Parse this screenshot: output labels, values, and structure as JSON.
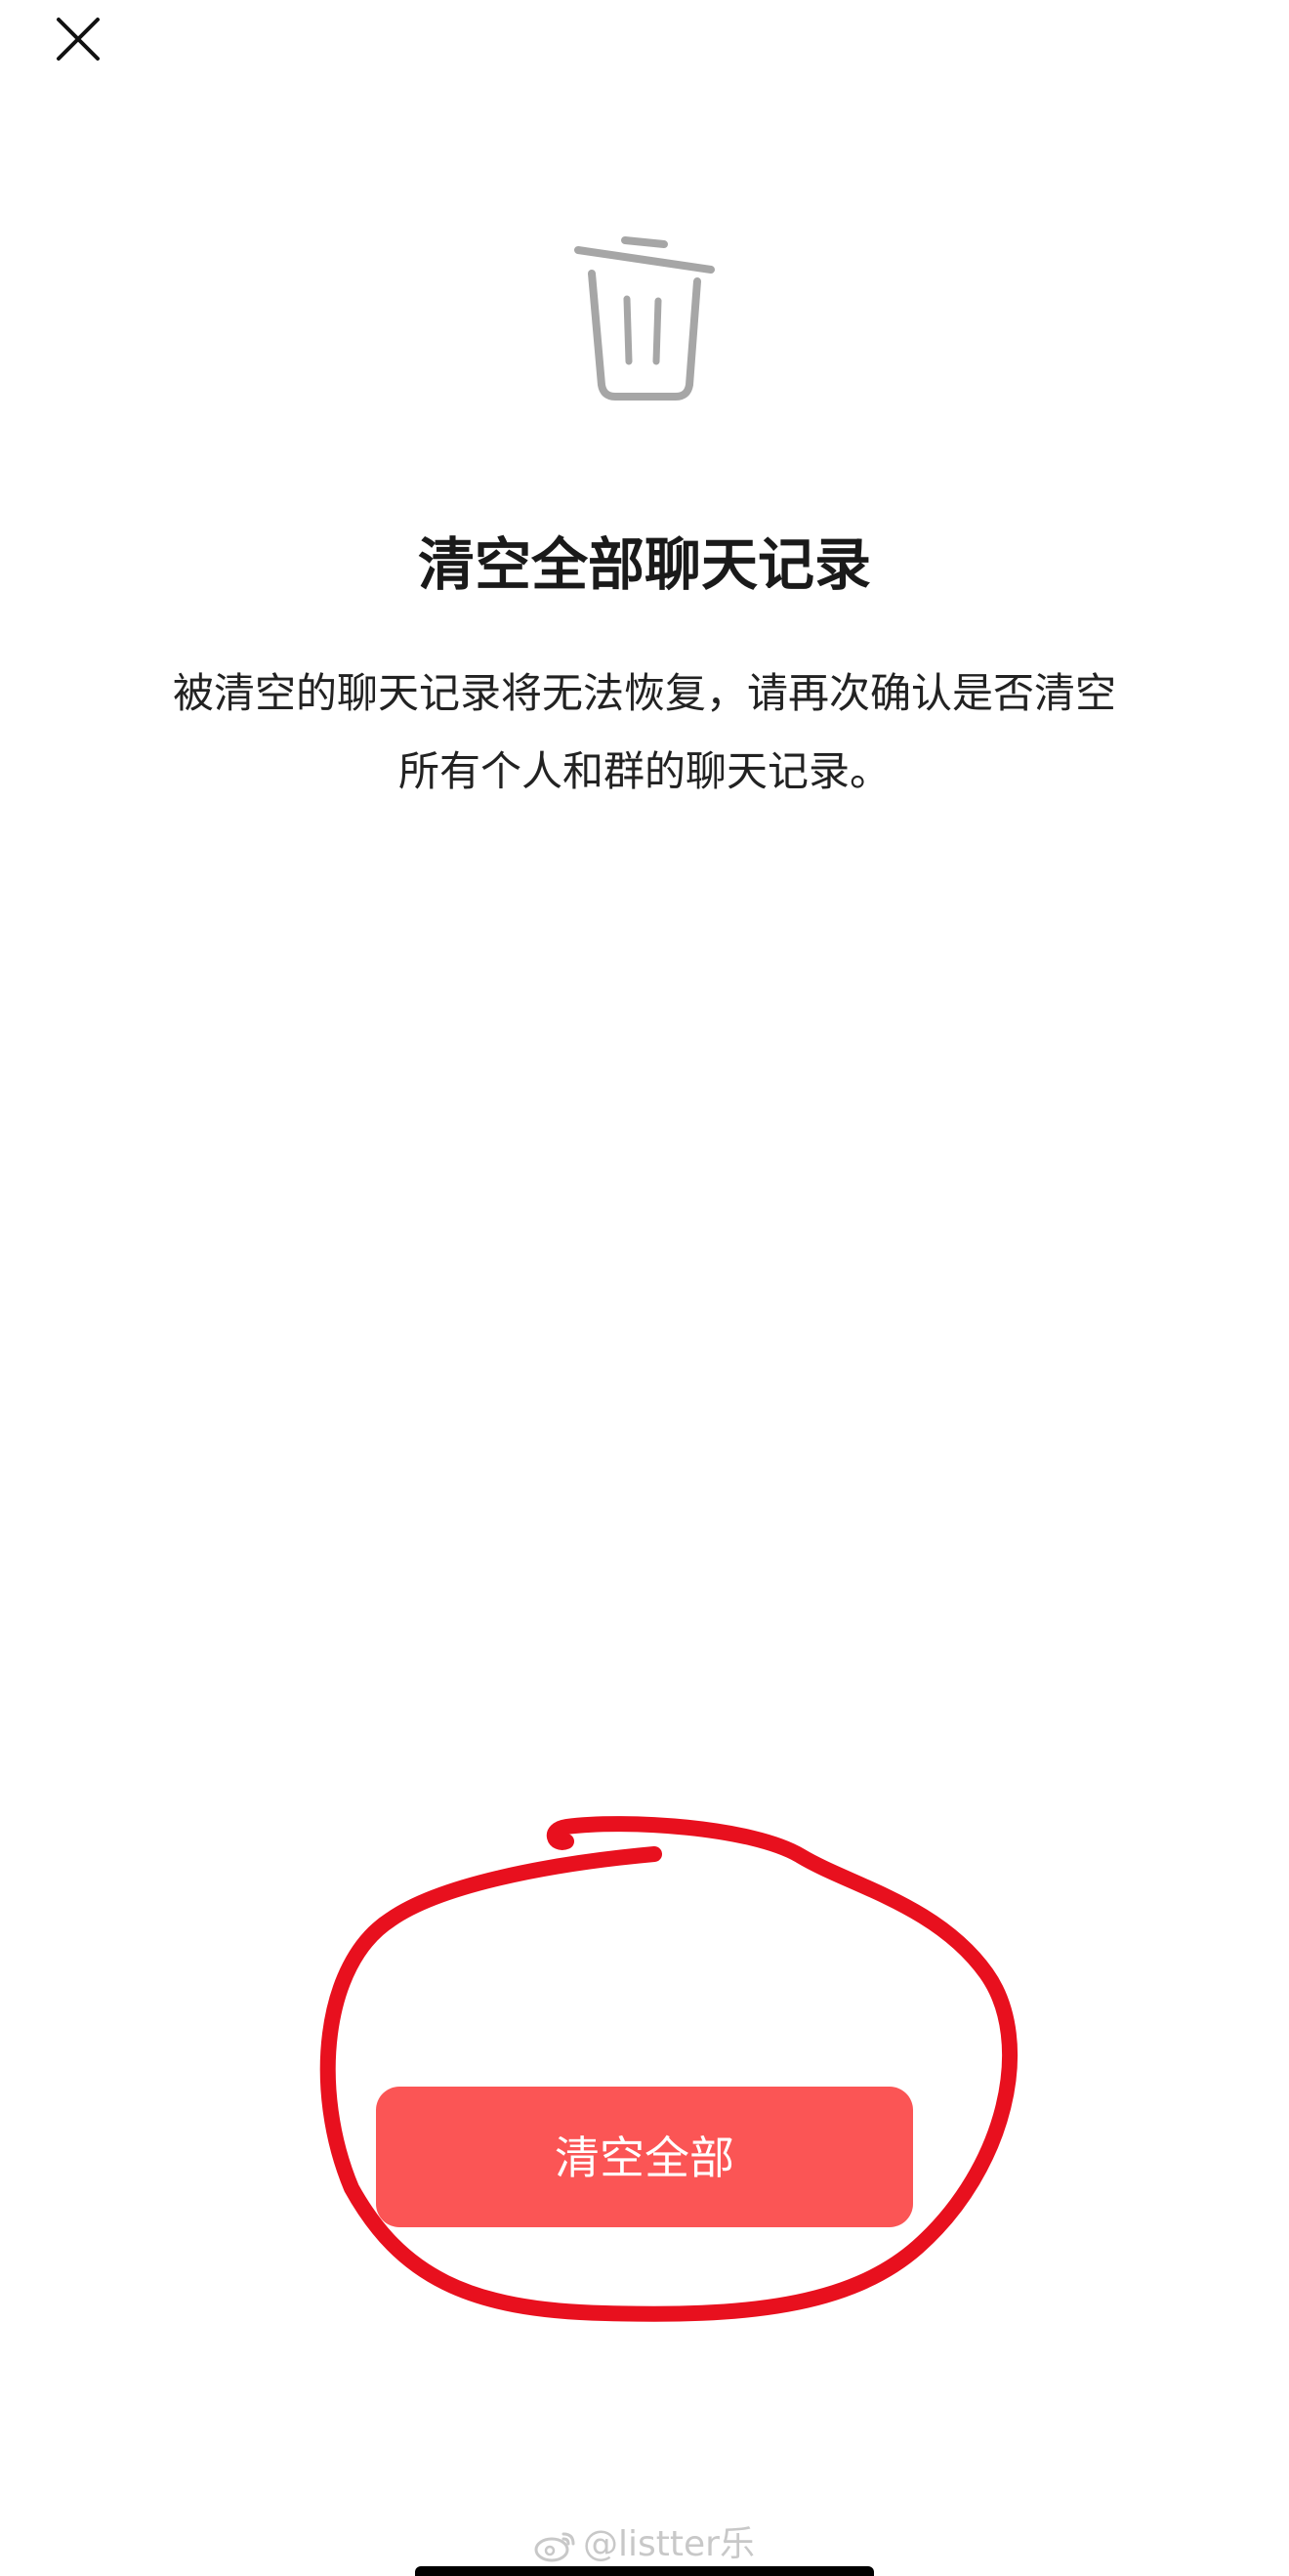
{
  "header": {
    "close_icon": "close-icon"
  },
  "hero": {
    "icon": "trash-icon",
    "title": "清空全部聊天记录",
    "description_lines": [
      "被清空的聊天记录将无法恢复，请再次确认是否清空",
      "所有个人和群的聊天记录。"
    ]
  },
  "actions": {
    "clear_all_label": "清空全部",
    "clear_all_color": "#fb5555"
  },
  "annotation": {
    "color": "#e8101e"
  },
  "watermark": {
    "text": "@listter乐"
  }
}
